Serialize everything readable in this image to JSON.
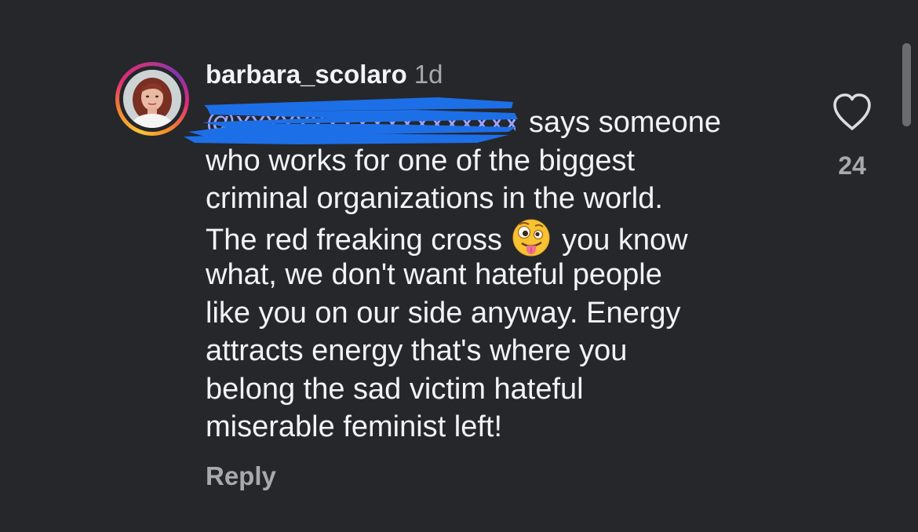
{
  "comment": {
    "username": "barbara_scolaro",
    "time": "1d",
    "mention": "@xxxxxxxxxxxxxxxxxxxxxxxxxxxxxxxxcole",
    "text_lines": [
      "says someone",
      "who works for one of the biggest",
      "criminal organizations in the world.",
      "The red freaking cross",
      "you know",
      "what, we don't want hateful people",
      "like you on our side anyway. Energy",
      "attracts energy that's where you",
      "belong the sad victim hateful",
      "miserable feminist left!"
    ],
    "emoji": "zany-face-emoji",
    "reply_label": "Reply",
    "like_count": "24"
  },
  "icons": {
    "like": "heart-outline-icon"
  },
  "colors": {
    "background": "#25272b",
    "text": "#f2f3f5",
    "muted": "#a6a9ae",
    "redaction": "#1d6fe8"
  }
}
